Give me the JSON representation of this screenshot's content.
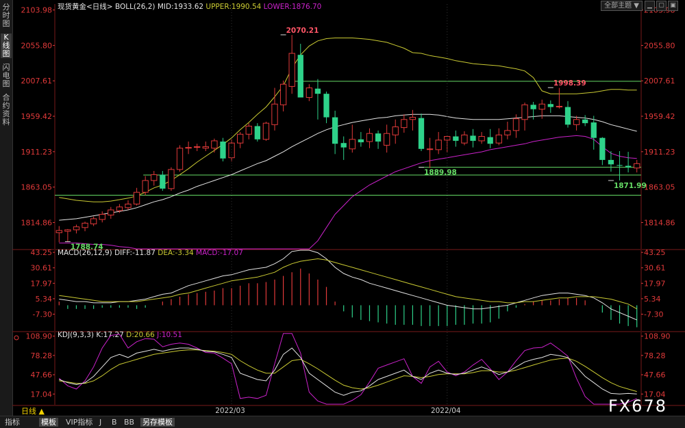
{
  "sidebar": {
    "tabs": [
      {
        "label": "分时图",
        "active": false
      },
      {
        "label": "K线图",
        "active": true
      },
      {
        "label": "闪电图",
        "active": false
      },
      {
        "label": "合约资料",
        "active": false
      }
    ]
  },
  "toolbar": {
    "theme_label": "全部主题",
    "theme_arrow": "▼"
  },
  "bottom_tabs": [
    {
      "label": "日线 ▲",
      "active": false,
      "color": "#f0d000"
    },
    {
      "label": "指标",
      "active": false
    },
    {
      "label": "模板",
      "active": true
    },
    {
      "label": "VIP指标",
      "active": false
    },
    {
      "label": "J",
      "active": false
    },
    {
      "label": "B",
      "active": false
    },
    {
      "label": "BB",
      "active": false
    },
    {
      "label": "另存模板",
      "active": true
    }
  ],
  "watermark": "FX678",
  "colors": {
    "up": "#e23a3a",
    "down": "#2ed28a",
    "mid": "#e6e6e6",
    "upper": "#cccc33",
    "lower": "#cc22cc",
    "hline": "#66dd66",
    "axis": "#e23a3a"
  },
  "chart_data": [
    {
      "type": "candlestick",
      "title_parts": [
        {
          "text": "现货黄金<日线>",
          "color": "#e6e6e6"
        },
        {
          "text": "BOLL(26,2)",
          "color": "#e6e6e6"
        },
        {
          "text": "MID:1933.62",
          "color": "#e6e6e6"
        },
        {
          "text": "UPPER:1990.54",
          "color": "#cccc33"
        },
        {
          "text": "LOWER:1876.70",
          "color": "#cc22cc"
        }
      ],
      "yticks": [
        "2103.98",
        "2055.80",
        "2007.61",
        "1959.42",
        "1911.23",
        "1863.05",
        "1814.86"
      ],
      "ylim": [
        1779,
        2112
      ],
      "xticks": [
        {
          "i": 20,
          "label": "2022/03"
        },
        {
          "i": 45,
          "label": "2022/04"
        }
      ],
      "annotations": [
        {
          "i": 26,
          "value": 2070.21,
          "label": "2070.21",
          "color": "#ff5566",
          "side": "right"
        },
        {
          "i": 57,
          "value": 1998.39,
          "label": "1998.39",
          "color": "#ff5566",
          "side": "right"
        },
        {
          "i": 42,
          "value": 1889.98,
          "label": "1889.98",
          "color": "#66dd66",
          "side": "right"
        },
        {
          "i": 1,
          "value": 1788.74,
          "label": "1788.74",
          "color": "#66dd66",
          "side": "right"
        },
        {
          "i": 64,
          "value": 1871.99,
          "label": "1871.99",
          "color": "#66dd66",
          "side": "right"
        }
      ],
      "hlines": [
        {
          "value": 2007.0,
          "from_i": 27,
          "to_i": 70
        },
        {
          "value": 1890.0,
          "from_i": 42,
          "to_i": 70
        },
        {
          "value": 1879.5,
          "from_i": 10,
          "to_i": 70
        },
        {
          "value": 1852.0,
          "from_i": 0,
          "to_i": 70
        }
      ],
      "candles": [
        [
          1801,
          1810,
          1788,
          1804
        ],
        [
          1803,
          1806,
          1789,
          1805
        ],
        [
          1805,
          1812,
          1800,
          1809
        ],
        [
          1808,
          1816,
          1803,
          1814
        ],
        [
          1813,
          1823,
          1810,
          1820
        ],
        [
          1819,
          1830,
          1815,
          1826
        ],
        [
          1825,
          1836,
          1820,
          1832
        ],
        [
          1831,
          1840,
          1828,
          1836
        ],
        [
          1835,
          1845,
          1832,
          1840
        ],
        [
          1840,
          1862,
          1838,
          1856
        ],
        [
          1856,
          1878,
          1852,
          1872
        ],
        [
          1872,
          1885,
          1865,
          1880
        ],
        [
          1880,
          1885,
          1858,
          1861
        ],
        [
          1861,
          1890,
          1858,
          1887
        ],
        [
          1887,
          1920,
          1884,
          1916
        ],
        [
          1916,
          1925,
          1908,
          1917
        ],
        [
          1918,
          1922,
          1912,
          1918
        ],
        [
          1916,
          1925,
          1912,
          1918
        ],
        [
          1916,
          1929,
          1910,
          1926
        ],
        [
          1925,
          1930,
          1898,
          1902
        ],
        [
          1903,
          1928,
          1898,
          1923
        ],
        [
          1923,
          1938,
          1916,
          1935
        ],
        [
          1935,
          1950,
          1928,
          1946
        ],
        [
          1946,
          1950,
          1925,
          1928
        ],
        [
          1928,
          1952,
          1926,
          1950
        ],
        [
          1948,
          1998,
          1940,
          1976
        ],
        [
          1975,
          2008,
          1966,
          2003
        ],
        [
          2000,
          2070,
          1990,
          2045
        ],
        [
          2043,
          2058,
          1992,
          1985
        ],
        [
          1985,
          2003,
          1980,
          1998
        ],
        [
          1997,
          2010,
          1955,
          1990
        ],
        [
          1990,
          1993,
          1950,
          1958
        ],
        [
          1958,
          1967,
          1908,
          1922
        ],
        [
          1923,
          1932,
          1900,
          1917
        ],
        [
          1915,
          1948,
          1910,
          1928
        ],
        [
          1928,
          1938,
          1918,
          1924
        ],
        [
          1925,
          1943,
          1916,
          1936
        ],
        [
          1936,
          1940,
          1915,
          1925
        ],
        [
          1920,
          1948,
          1910,
          1936
        ],
        [
          1934,
          1955,
          1922,
          1945
        ],
        [
          1944,
          1962,
          1937,
          1955
        ],
        [
          1955,
          1968,
          1940,
          1958
        ],
        [
          1957,
          1963,
          1912,
          1915
        ],
        [
          1915,
          1930,
          1889,
          1915
        ],
        [
          1914,
          1938,
          1908,
          1927
        ],
        [
          1927,
          1933,
          1910,
          1932
        ],
        [
          1932,
          1940,
          1918,
          1926
        ],
        [
          1923,
          1939,
          1920,
          1934
        ],
        [
          1933,
          1942,
          1917,
          1926
        ],
        [
          1926,
          1938,
          1922,
          1932
        ],
        [
          1931,
          1942,
          1916,
          1922
        ],
        [
          1923,
          1943,
          1920,
          1934
        ],
        [
          1934,
          1952,
          1928,
          1940
        ],
        [
          1940,
          1962,
          1930,
          1956
        ],
        [
          1955,
          1978,
          1940,
          1975
        ],
        [
          1975,
          1979,
          1955,
          1969
        ],
        [
          1969,
          1982,
          1956,
          1976
        ],
        [
          1976,
          1981,
          1964,
          1972
        ],
        [
          1973,
          1998,
          1970,
          1973
        ],
        [
          1972,
          1980,
          1944,
          1948
        ],
        [
          1948,
          1960,
          1940,
          1955
        ],
        [
          1955,
          1961,
          1946,
          1950
        ],
        [
          1951,
          1960,
          1914,
          1930
        ],
        [
          1930,
          1931,
          1893,
          1900
        ],
        [
          1900,
          1912,
          1884,
          1894
        ],
        [
          1893,
          1912,
          1872,
          1892
        ],
        [
          1892,
          1911,
          1883,
          1890
        ],
        [
          1889,
          1900,
          1883,
          1895
        ]
      ],
      "mid": [
        1818,
        1819,
        1820,
        1822,
        1824,
        1826,
        1828,
        1830,
        1832,
        1835,
        1839,
        1843,
        1846,
        1850,
        1855,
        1859,
        1864,
        1868,
        1872,
        1876,
        1880,
        1885,
        1890,
        1895,
        1899,
        1905,
        1911,
        1918,
        1924,
        1930,
        1936,
        1941,
        1945,
        1948,
        1951,
        1953,
        1955,
        1957,
        1958,
        1960,
        1961,
        1962,
        1962,
        1962,
        1961,
        1959,
        1957,
        1956,
        1955,
        1955,
        1955,
        1955,
        1956,
        1957,
        1958,
        1959,
        1960,
        1960,
        1960,
        1959,
        1958,
        1957,
        1955,
        1952,
        1948,
        1945,
        1942,
        1939
      ],
      "upper": [
        1849,
        1847,
        1845,
        1844,
        1843,
        1843,
        1844,
        1846,
        1848,
        1851,
        1856,
        1862,
        1866,
        1872,
        1880,
        1888,
        1897,
        1905,
        1913,
        1921,
        1930,
        1941,
        1951,
        1962,
        1972,
        1986,
        2001,
        2025,
        2043,
        2055,
        2062,
        2065,
        2066,
        2066,
        2066,
        2065,
        2064,
        2062,
        2060,
        2056,
        2052,
        2046,
        2045,
        2042,
        2040,
        2038,
        2035,
        2033,
        2031,
        2030,
        2029,
        2028,
        2026,
        2024,
        2021,
        2012,
        1994,
        1990,
        1990,
        1990,
        1990,
        1991,
        1992,
        1994,
        1996,
        1996,
        1995,
        1995
      ],
      "lower": [
        1787,
        1787,
        1787,
        1786,
        1785,
        1785,
        1784,
        1782,
        1781,
        1779,
        1778,
        1776,
        1774,
        1772,
        1770,
        1768,
        1767,
        1765,
        1764,
        1763,
        1762,
        1761,
        1760,
        1759,
        1759,
        1759,
        1759,
        1759,
        1760,
        1775,
        1790,
        1808,
        1826,
        1838,
        1850,
        1858,
        1866,
        1872,
        1878,
        1884,
        1888,
        1892,
        1896,
        1899,
        1901,
        1903,
        1905,
        1907,
        1909,
        1911,
        1914,
        1916,
        1918,
        1920,
        1922,
        1925,
        1927,
        1929,
        1931,
        1932,
        1933,
        1932,
        1928,
        1918,
        1909,
        1905,
        1903,
        1902
      ]
    },
    {
      "type": "bar",
      "title_parts": [
        {
          "text": "MACD(26,12,9)",
          "color": "#e6e6e6"
        },
        {
          "text": "DIFF:-11.87",
          "color": "#e6e6e6"
        },
        {
          "text": "DEA:-3.34",
          "color": "#cccc33"
        },
        {
          "text": "MACD:-17.07",
          "color": "#cc22cc"
        }
      ],
      "yticks": [
        "43.25",
        "30.61",
        "17.97",
        "5.34",
        "-7.30"
      ],
      "ylim": [
        -21,
        45
      ],
      "macd": [
        3,
        -3,
        -3,
        -3,
        -3,
        -2,
        -2,
        -2,
        -2,
        -3,
        -2,
        0,
        3,
        5,
        7,
        9,
        10,
        11,
        12,
        14,
        14,
        16,
        18,
        18,
        19,
        21,
        24,
        27,
        30,
        26,
        21,
        15,
        3,
        -5,
        -10,
        -12,
        -13,
        -14,
        -15,
        -16,
        -16,
        -16,
        -17,
        -17,
        -17,
        -17,
        -16,
        -16,
        -15,
        -15,
        -14,
        -11,
        -5,
        -2,
        1,
        3,
        4,
        4,
        5,
        6,
        6,
        4,
        0,
        -6,
        -12,
        -15,
        -17,
        -18
      ],
      "diff": [
        5,
        4,
        3,
        3,
        2,
        2,
        2,
        3,
        3,
        4,
        5,
        7,
        9,
        10,
        13,
        16,
        18,
        20,
        22,
        24,
        25,
        27,
        29,
        30,
        31,
        34,
        38,
        44,
        45,
        45,
        43,
        38,
        31,
        26,
        23,
        21,
        18,
        16,
        14,
        12,
        10,
        8,
        6,
        4,
        2,
        0,
        -1,
        -2,
        -3,
        -3,
        -2,
        -1,
        0,
        2,
        4,
        6,
        8,
        9,
        10,
        10,
        9,
        8,
        6,
        2,
        -3,
        -6,
        -9,
        -12
      ],
      "dea": [
        8,
        7,
        6,
        5,
        4,
        3,
        3,
        3,
        3,
        3,
        4,
        5,
        6,
        7,
        9,
        10,
        12,
        14,
        16,
        18,
        20,
        21,
        22,
        23,
        25,
        27,
        31,
        34,
        36,
        37,
        38,
        37,
        35,
        33,
        31,
        29,
        27,
        25,
        23,
        21,
        19,
        17,
        15,
        13,
        11,
        9,
        7,
        6,
        5,
        4,
        3,
        3,
        2,
        2,
        3,
        3,
        4,
        5,
        6,
        6,
        7,
        7,
        7,
        6,
        5,
        3,
        1,
        -3
      ]
    },
    {
      "type": "line",
      "title_parts": [
        {
          "text": "KDJ(9,3,3)",
          "color": "#e6e6e6"
        },
        {
          "text": "K:17.27",
          "color": "#e6e6e6"
        },
        {
          "text": "D:20.66",
          "color": "#cccc33"
        },
        {
          "text": "J:10.51",
          "color": "#cc22cc"
        }
      ],
      "yticks": [
        "108.90",
        "78.28",
        "47.66",
        "17.04"
      ],
      "ylim": [
        0,
        115
      ],
      "k": [
        40,
        35,
        32,
        35,
        45,
        60,
        75,
        80,
        75,
        82,
        85,
        88,
        85,
        88,
        90,
        90,
        88,
        85,
        84,
        80,
        75,
        50,
        45,
        40,
        38,
        55,
        80,
        90,
        75,
        50,
        40,
        30,
        20,
        15,
        20,
        22,
        30,
        40,
        45,
        50,
        55,
        45,
        40,
        50,
        55,
        50,
        48,
        50,
        55,
        60,
        55,
        48,
        52,
        60,
        68,
        72,
        75,
        80,
        78,
        75,
        60,
        45,
        35,
        25,
        18,
        17,
        18,
        17
      ],
      "d": [
        38,
        36,
        34,
        34,
        38,
        46,
        56,
        64,
        68,
        72,
        76,
        80,
        82,
        84,
        86,
        87,
        87,
        86,
        85,
        83,
        80,
        70,
        62,
        55,
        50,
        50,
        60,
        70,
        72,
        65,
        57,
        48,
        39,
        31,
        27,
        25,
        27,
        31,
        36,
        41,
        46,
        45,
        43,
        45,
        48,
        49,
        49,
        49,
        51,
        54,
        54,
        52,
        52,
        55,
        59,
        63,
        67,
        71,
        73,
        74,
        69,
        61,
        52,
        43,
        35,
        29,
        25,
        21
      ],
      "j": [
        42,
        30,
        25,
        38,
        60,
        90,
        110,
        112,
        90,
        100,
        105,
        104,
        92,
        96,
        98,
        96,
        90,
        83,
        82,
        74,
        65,
        10,
        12,
        10,
        15,
        65,
        120,
        130,
        82,
        20,
        6,
        -5,
        -20,
        -18,
        7,
        16,
        36,
        58,
        63,
        68,
        73,
        45,
        34,
        60,
        69,
        52,
        46,
        52,
        63,
        72,
        57,
        40,
        52,
        70,
        86,
        90,
        91,
        98,
        88,
        77,
        42,
        13,
        1,
        -11,
        -16,
        -7,
        4,
        10
      ]
    }
  ]
}
